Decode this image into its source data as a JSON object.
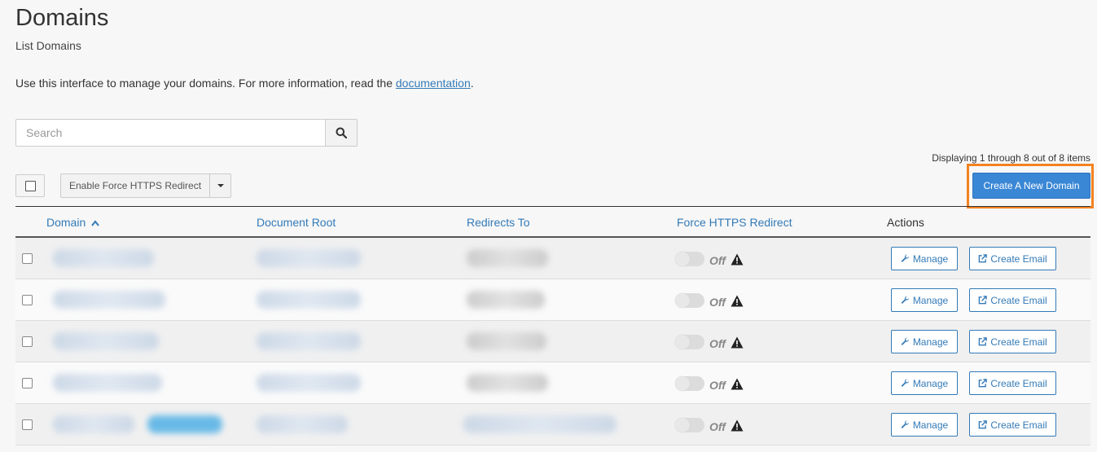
{
  "page": {
    "title": "Domains",
    "subtitle": "List Domains",
    "intro_text": "Use this interface to manage your domains. For more information, read the ",
    "intro_link": "documentation",
    "intro_end": "."
  },
  "search": {
    "placeholder": "Search",
    "icon": "search-icon"
  },
  "display_count": "Displaying 1 through 8 out of 8 items",
  "bulk": {
    "label": "Enable Force HTTPS Redirect",
    "caret_icon": "caret-down-icon"
  },
  "create_button": "Create A New Domain",
  "highlight_color": "#f58220",
  "table": {
    "columns": {
      "domain": "Domain",
      "document_root": "Document Root",
      "redirects_to": "Redirects To",
      "force_https": "Force HTTPS Redirect",
      "actions": "Actions"
    },
    "rows": [
      {
        "force_https_state": "Off",
        "manage": "Manage",
        "create_email": "Create Email"
      },
      {
        "force_https_state": "Off",
        "manage": "Manage",
        "create_email": "Create Email"
      },
      {
        "force_https_state": "Off",
        "manage": "Manage",
        "create_email": "Create Email"
      },
      {
        "force_https_state": "Off",
        "manage": "Manage",
        "create_email": "Create Email"
      },
      {
        "force_https_state": "Off",
        "manage": "Manage",
        "create_email": "Create Email"
      }
    ]
  },
  "colors": {
    "link": "#337ab7",
    "primary": "#3a87d6"
  }
}
